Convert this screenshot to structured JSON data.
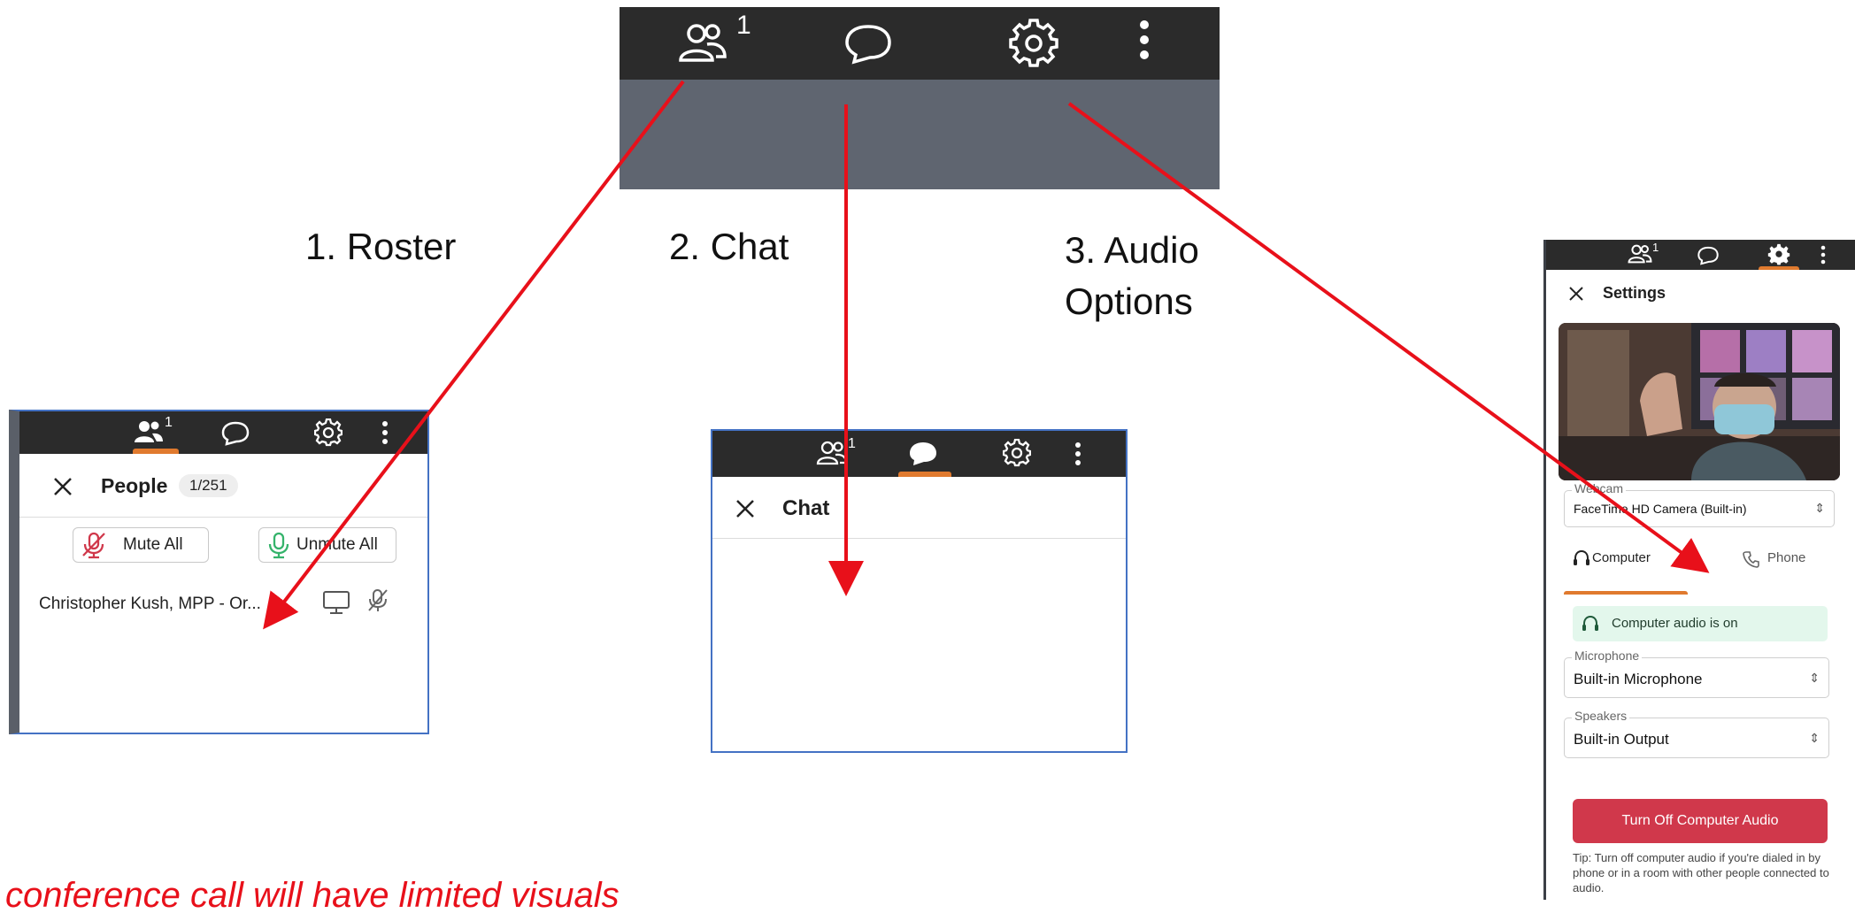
{
  "top_toolbar": {
    "people_count": "1"
  },
  "annotations": {
    "roster": "1. Roster",
    "chat": "2. Chat",
    "audio_line1": "3. Audio",
    "audio_line2": "Options",
    "footer_note": "conference call will have limited visuals"
  },
  "people_panel": {
    "people_count": "1",
    "title": "People",
    "count_badge": "1/251",
    "mute_all_label": "Mute All",
    "unmute_all_label": "Unmute All",
    "participant_name": "Christopher Kush, MPP - Or..."
  },
  "chat_panel": {
    "people_count": "1",
    "title": "Chat"
  },
  "settings_panel": {
    "people_count": "1",
    "title": "Settings",
    "webcam": {
      "label": "Webcam",
      "value": "FaceTime HD Camera (Built-in)"
    },
    "tabs": {
      "computer": "Computer",
      "phone": "Phone"
    },
    "status_text": "Computer audio is on",
    "microphone": {
      "label": "Microphone",
      "value": "Built-in Microphone"
    },
    "speakers": {
      "label": "Speakers",
      "value": "Built-in Output"
    },
    "turn_off_label": "Turn Off Computer Audio",
    "tip_text": "Tip: Turn off computer audio if you're dialed in by phone or in a room with other people connected to audio."
  },
  "colors": {
    "toolbar": "#2b2b2b",
    "video_area": "#5f6570",
    "accent": "#e07a2e",
    "danger": "#d0384b",
    "success_bg": "#e3f7ec",
    "arrow": "#e8101a",
    "panel_border": "#4472c4"
  },
  "icons": [
    "people-icon",
    "chat-icon",
    "gear-icon",
    "more-vertical-icon",
    "close-icon",
    "mic-off-icon",
    "mic-icon",
    "monitor-icon",
    "headset-icon",
    "phone-icon"
  ]
}
